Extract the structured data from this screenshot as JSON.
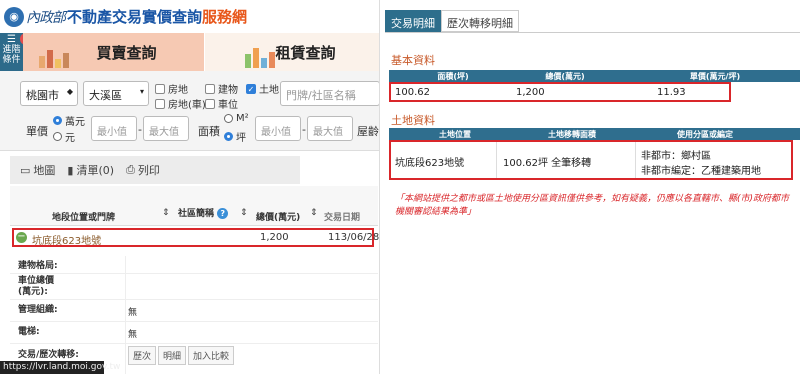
{
  "header": {
    "logo_script": "內政部",
    "title": "不動產交易實價查詢",
    "subtitle": "服務網"
  },
  "advanced": {
    "label_line1": "進階",
    "label_line2": "條件",
    "badge": "!"
  },
  "main_tabs": [
    {
      "label": "買賣查詢",
      "active": true
    },
    {
      "label": "租賃查詢",
      "active": false
    }
  ],
  "filters": {
    "city": "桃園市",
    "district": "大溪區",
    "types": [
      {
        "label": "房地",
        "checked": false
      },
      {
        "label": "建物",
        "checked": false
      },
      {
        "label": "土地",
        "checked": true
      },
      {
        "label": "房地(車)",
        "checked": false
      },
      {
        "label": "車位",
        "checked": false
      }
    ],
    "address_placeholder": "門牌/社區名稱",
    "unit_price_label": "單價",
    "unit_options": [
      {
        "label": "萬元",
        "selected": true
      },
      {
        "label": "元",
        "selected": false
      }
    ],
    "min_placeholder": "最小值",
    "max_placeholder": "最大值",
    "dash": "-",
    "area_label": "面積",
    "area_options": [
      {
        "label": "M²",
        "selected": false
      },
      {
        "label": "坪",
        "selected": true
      }
    ],
    "age_label": "屋齡"
  },
  "toolbar": {
    "map": "地圖",
    "list": "清單(0)",
    "print": "列印"
  },
  "table": {
    "headers": [
      "地段位置或門牌",
      "社區簡稱",
      "總價(萬元)",
      "交易日期"
    ],
    "row": {
      "location": "坑底段623地號",
      "total": "1,200",
      "date": "113/06/28"
    }
  },
  "detail": {
    "building_type": "建物格局:",
    "parking_price_l1": "車位總價",
    "parking_price_l2": "(萬元):",
    "management": "管理組織:",
    "management_value": "無",
    "elevator": "電梯:",
    "elevator_value": "無",
    "history": "交易/歷次轉移:",
    "history_buttons": [
      "歷次",
      "明細",
      "加入比較"
    ]
  },
  "statusbar": "https://lvr.land.moi.gov.tw",
  "right": {
    "tabs": [
      {
        "label": "交易明細",
        "active": true
      },
      {
        "label": "歷次轉移明細",
        "active": false
      }
    ],
    "basic": {
      "title": "基本資料",
      "headers": [
        "面積(坪)",
        "總價(萬元)",
        "單價(萬元/坪)"
      ],
      "values": [
        "100.62",
        "1,200",
        "11.93"
      ]
    },
    "land": {
      "title": "土地資料",
      "headers": [
        "土地位置",
        "土地移轉面積",
        "使用分區或編定"
      ],
      "location": "坑底段623地號",
      "area": "100.62坪 全筆移轉",
      "zone_line1": "非都市：鄉村區",
      "zone_line2": "非都市編定：乙種建築用地"
    },
    "note_line1": "「本網站提供之都市或區土地使用分區資訊僅供參考，如有疑義，仍應以各直轄市、縣(市)政府都市",
    "note_line2": "機關審認結果為準」"
  },
  "colors": {
    "brand_blue": "#1a56a6",
    "brand_orange": "#e8571b",
    "highlight_red": "#d9262a",
    "header_teal": "#2f6e8e"
  }
}
